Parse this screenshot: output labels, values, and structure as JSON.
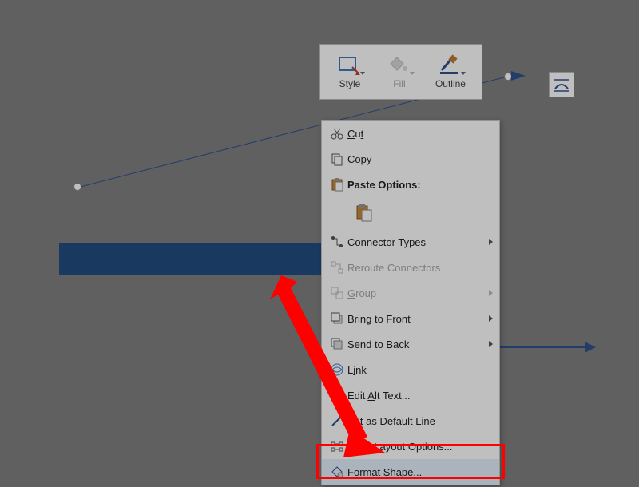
{
  "miniToolbar": {
    "style": "Style",
    "fill": "Fill",
    "outline": "Outline"
  },
  "contextMenu": {
    "cut": "Cut",
    "copy": "Copy",
    "pasteOptionsHeader": "Paste Options:",
    "connectorTypes": "Connector Types",
    "rerouteConnectors": "Reroute Connectors",
    "group": "Group",
    "bringToFront": "Bring to Front",
    "sendToBack": "Send to Back",
    "link": "Link",
    "editAltText": "Edit Alt Text...",
    "setDefaultLine": "Set as Default Line",
    "moreLayoutOptions": "More Layout Options...",
    "formatShape": "Format Shape..."
  },
  "colors": {
    "accent": "#2f528f",
    "barFill": "#234d80",
    "callout": "#ff0000"
  }
}
